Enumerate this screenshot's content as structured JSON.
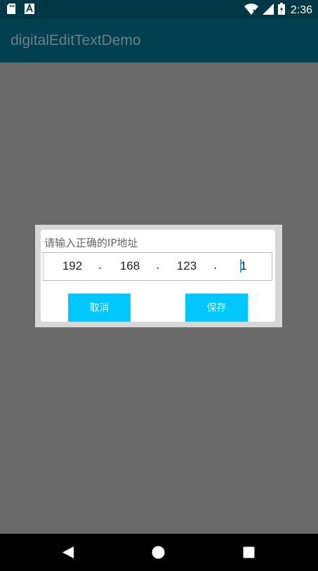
{
  "status_bar": {
    "time": "2:36",
    "icons": [
      "sd-card-icon",
      "a-notification-icon",
      "wifi-icon",
      "signal-icon",
      "battery-icon"
    ]
  },
  "app_bar": {
    "title": "digitalEditTextDemo"
  },
  "dialog": {
    "title": "请输入正确的IP地址",
    "ip": {
      "octets": [
        "192",
        "168",
        "123",
        "1"
      ],
      "separator": "."
    },
    "cancel_label": "取消",
    "save_label": "保存"
  },
  "colors": {
    "status_bar": "#013846",
    "app_bar": "#023f4f",
    "backdrop": "#696969",
    "button": "#00c8ff",
    "cursor": "#1eb6f0"
  },
  "nav_bar": {
    "icons": [
      "back-icon",
      "home-icon",
      "recents-icon"
    ]
  }
}
